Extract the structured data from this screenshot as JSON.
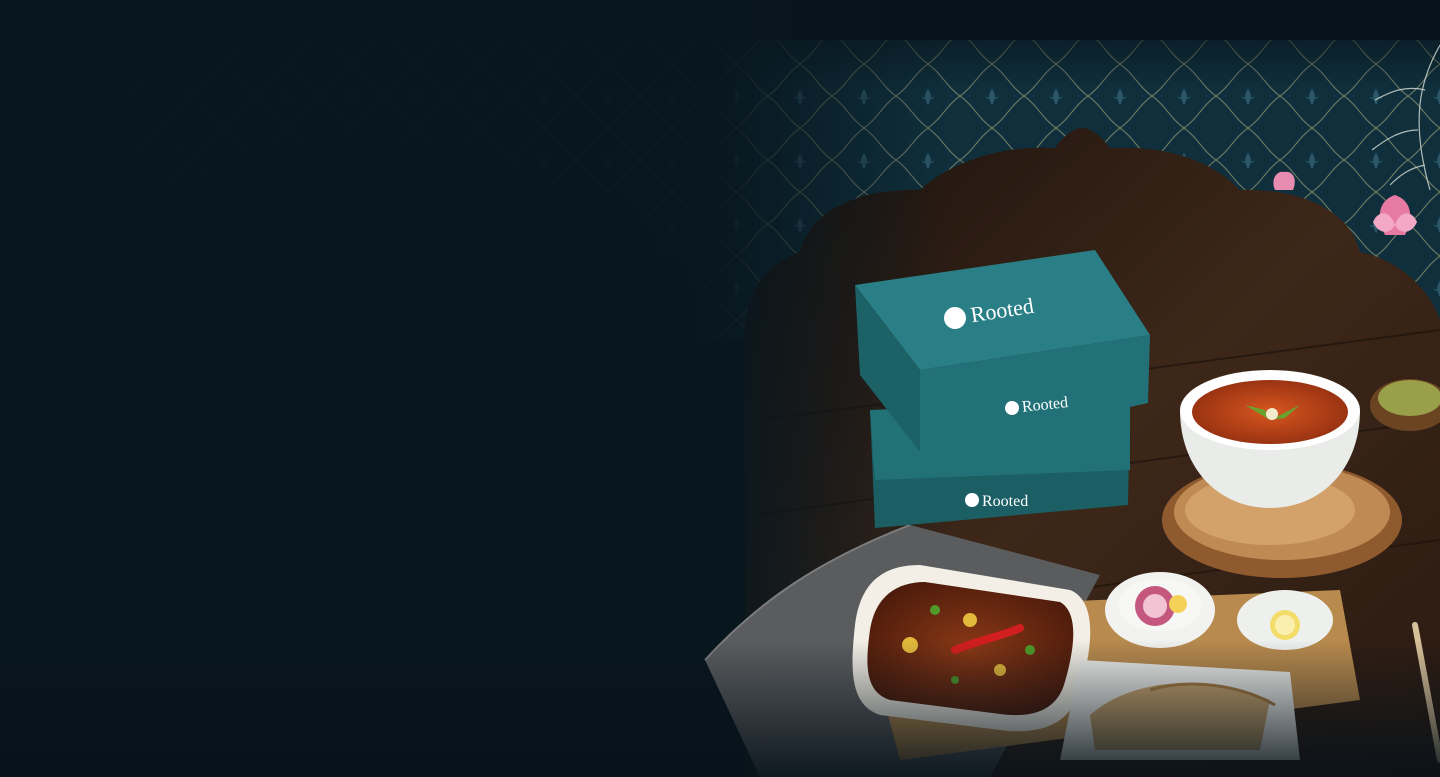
{
  "brand": {
    "name": "Rooted",
    "logo_mark": "rooted-leaf-icon",
    "accent_color": "#1f6b70"
  },
  "palette": {
    "background": "#07121a",
    "pattern": "#0f2f3c",
    "pattern_line": "#6b7a62",
    "wood": "#3a2418",
    "box_teal": "#1e6f74",
    "curry": "#7a2a12",
    "soup": "#c2471c"
  },
  "scene": {
    "boxes": [
      {
        "label": "Rooted"
      },
      {
        "label": "Rooted"
      },
      {
        "label": "Rooted"
      }
    ]
  }
}
